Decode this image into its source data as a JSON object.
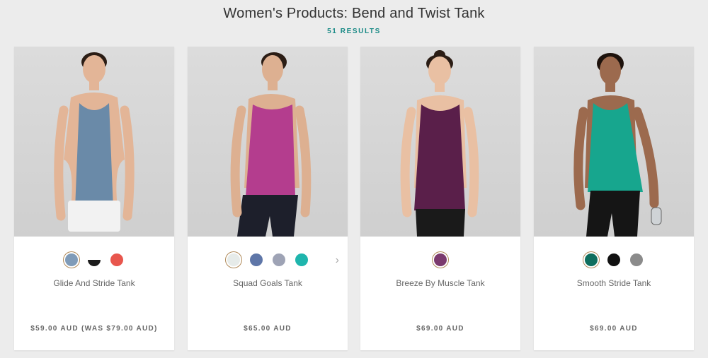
{
  "header": {
    "title": "Women's Products: Bend and Twist Tank",
    "results": "51 RESULTS"
  },
  "products": [
    {
      "name": "Glide And Stride Tank",
      "price": "$59.00 AUD (WAS $79.00 AUD)",
      "tank_color": "#6a8aa8",
      "swatches": [
        "#7f9bb8",
        "#1c1c1c",
        "#e8564d"
      ]
    },
    {
      "name": "Squad Goals Tank",
      "price": "$65.00 AUD",
      "tank_color": "#b43d8e",
      "swatches": [
        "#e6ebe9",
        "#5e76a8",
        "#9ea3b5",
        "#1fb5ad"
      ],
      "next_icon": "chevron-right-icon"
    },
    {
      "name": "Breeze By Muscle Tank",
      "price": "$69.00 AUD",
      "tank_color": "#5a1f4a",
      "swatches": [
        "#7b3a6e"
      ]
    },
    {
      "name": "Smooth Stride Tank",
      "price": "$69.00 AUD",
      "tank_color": "#17a68e",
      "swatches": [
        "#0f6e5e",
        "#111111",
        "#8b8b8b"
      ]
    }
  ]
}
